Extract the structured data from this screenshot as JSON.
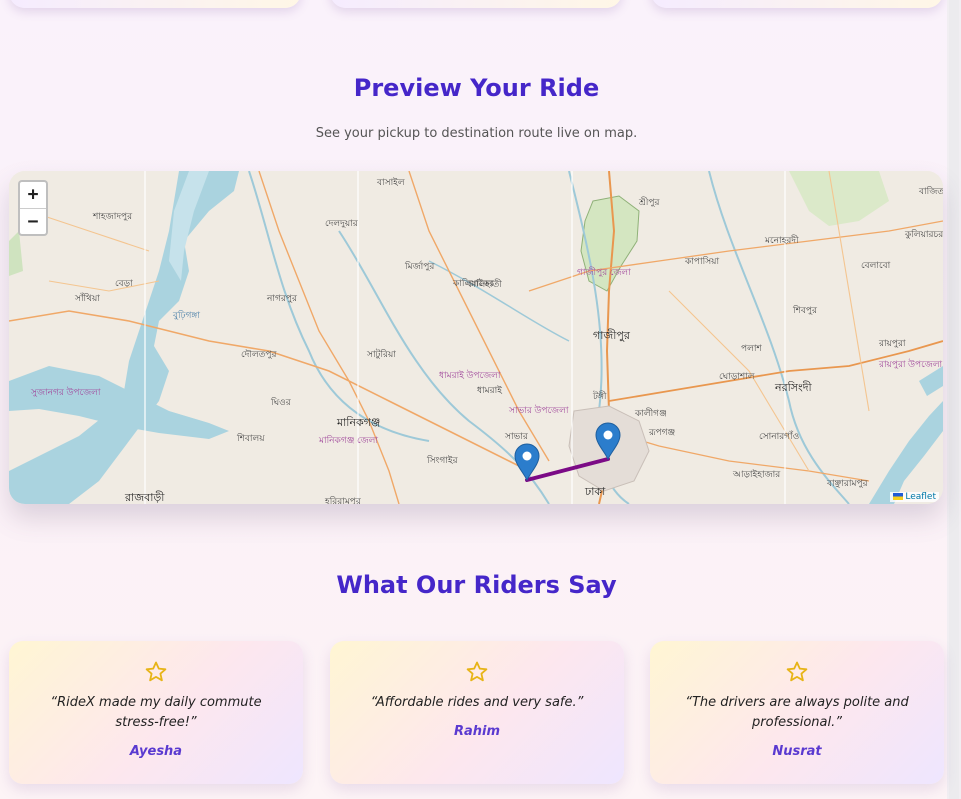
{
  "ride_preview": {
    "title": "Preview Your Ride",
    "subtitle": "See your pickup to destination route live on map."
  },
  "map": {
    "zoom_in": "+",
    "zoom_out": "−",
    "attribution": "Leaflet",
    "route_color": "#7b0a86",
    "labels": [
      "শাহজাদপুর",
      "বেড়া",
      "সাঁথিয়া",
      "কালিহাতী",
      "বাসাইল",
      "দেলদুয়ার",
      "মির্জাপুর",
      "শ্রীপুর",
      "গাজীপুর জেলা",
      "কাপাসিয়া",
      "মনোহরদী",
      "বেলাবো",
      "কুলিয়ারচর",
      "বাজিতপুর",
      "নাগরপুর",
      "দৌলতপুর",
      "সাটুরিয়া",
      "কালিয়াকৈর",
      "গাজীপুর",
      "পলাশ",
      "শিবপুর",
      "রায়পুরা",
      "রায়পুরা উপজেলা",
      "ধামরাই উপজেলা",
      "ধামরাই",
      "ঘোড়াশাল",
      "নরসিংদী",
      "টঙ্গী",
      "সাভার উপজেলা",
      "মানিকগঞ্জ",
      "মানিকগঞ্জ জেলা",
      "শিবালয়",
      "ঘিওর",
      "সাভার",
      "সিংগাইর",
      "ঢাকা",
      "রূপগঞ্জ",
      "আড়াইহাজার",
      "বাঞ্ছারামপুর",
      "সোনারগাঁও",
      "রাজবাড়ী",
      "সুজানগর উপজেলা",
      "বুঢ়িগঙ্গা",
      "হরিরামপুর",
      "কালীগঞ্জ"
    ]
  },
  "testimonials": {
    "title": "What Our Riders Say",
    "items": [
      {
        "quote": "“RideX made my daily commute stress-free!”",
        "name": "Ayesha"
      },
      {
        "quote": "“Affordable rides and very safe.”",
        "name": "Rahim"
      },
      {
        "quote": "“The drivers are always polite and professional.”",
        "name": "Nusrat"
      }
    ]
  },
  "colors": {
    "accent": "#4527c9",
    "star": "#e7b416"
  }
}
